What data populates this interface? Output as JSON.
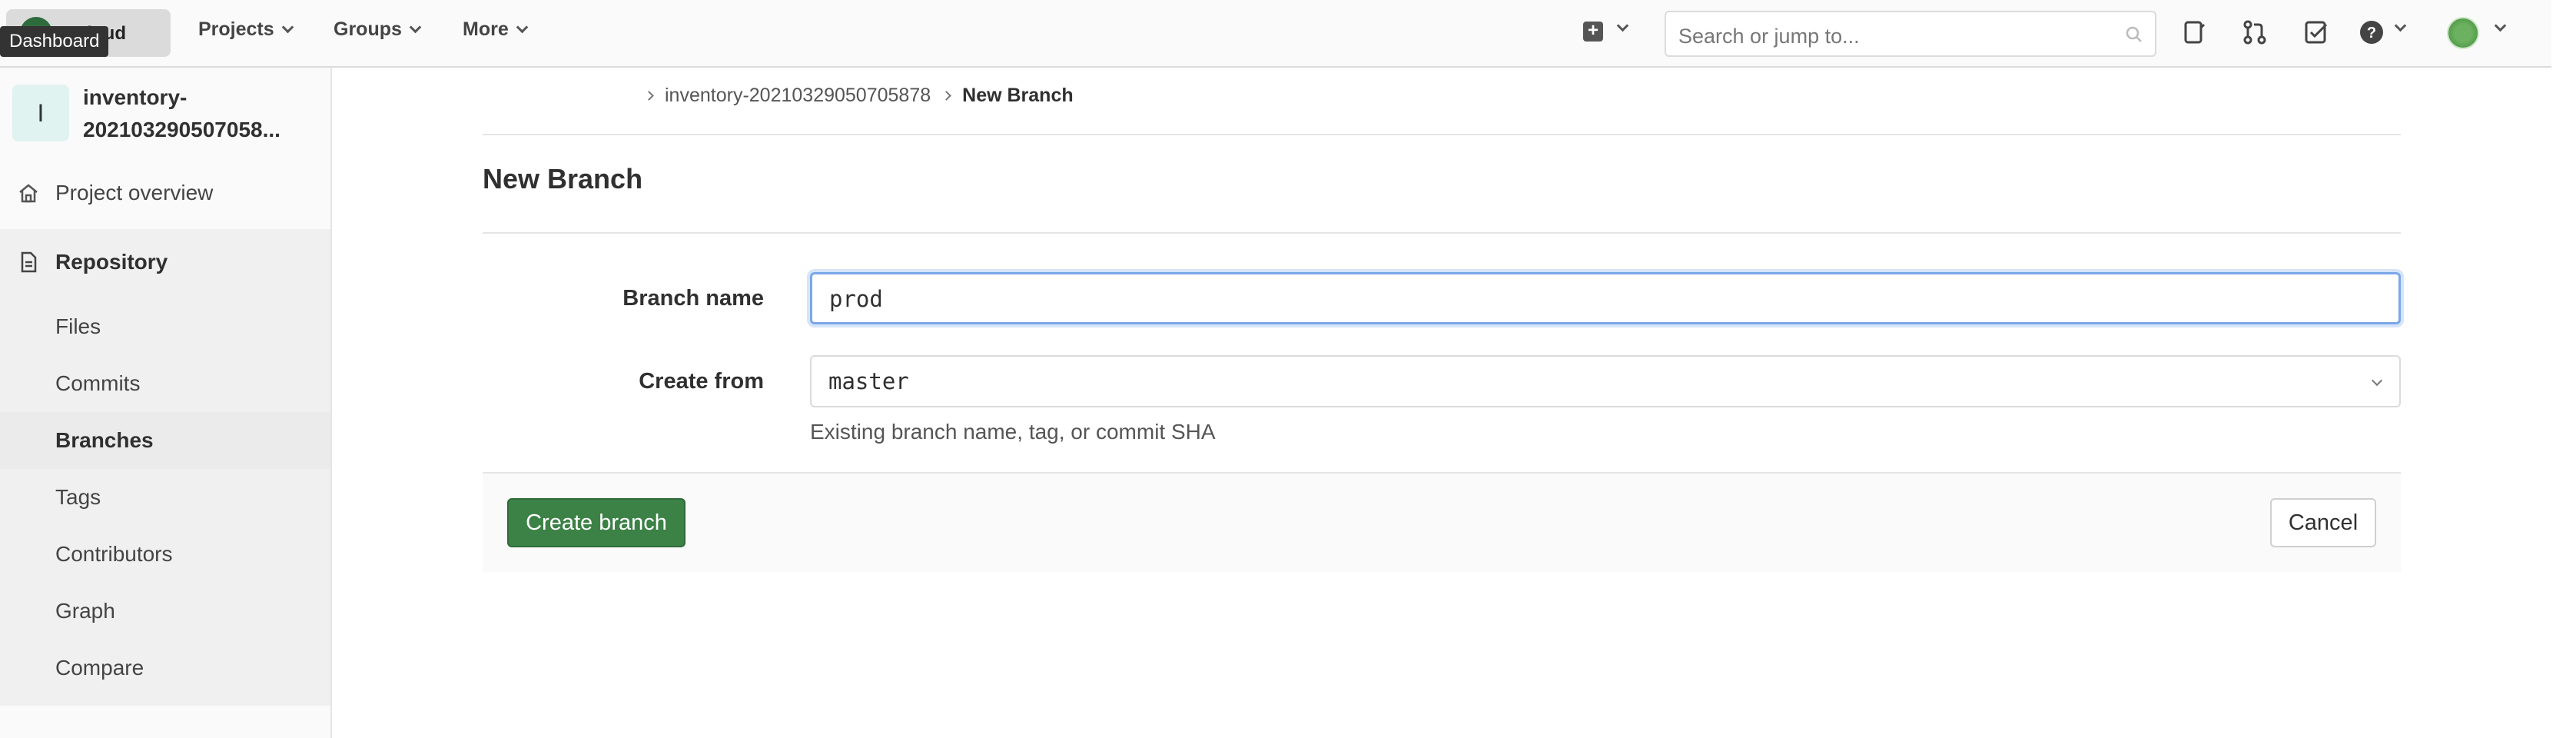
{
  "topbar": {
    "brand_text": "Cloud",
    "tooltip": "Dashboard",
    "nav": [
      "Projects",
      "Groups",
      "More"
    ],
    "search_placeholder": "Search or jump to...",
    "icons": [
      "plus-square-icon",
      "todo-doc-icon",
      "merge-request-icon",
      "check-square-icon",
      "help-icon",
      "user-avatar"
    ]
  },
  "sidebar": {
    "project_initial": "I",
    "project_name": "inventory-202103290507058...",
    "project_overview": "Project overview",
    "repository": "Repository",
    "sub_items": [
      "Files",
      "Commits",
      "Branches",
      "Tags",
      "Contributors",
      "Graph",
      "Compare"
    ],
    "active_item": "Branches"
  },
  "breadcrumb": {
    "project": "inventory-20210329050705878",
    "current": "New Branch"
  },
  "page": {
    "title": "New Branch",
    "branch_label": "Branch name",
    "branch_value": "prod",
    "create_from_label": "Create from",
    "create_from_value": "master",
    "help_text": "Existing branch name, tag, or commit SHA",
    "create_button": "Create branch",
    "cancel_button": "Cancel"
  },
  "colors": {
    "primary_button": "#3c8146",
    "focus_ring": "#7aa7e8"
  }
}
